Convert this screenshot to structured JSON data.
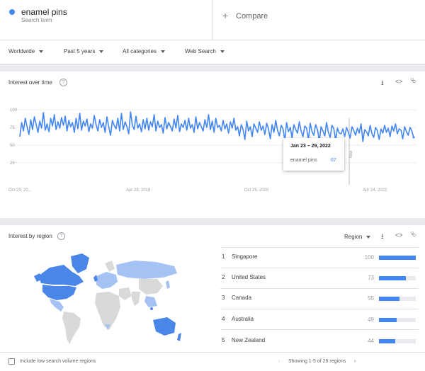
{
  "search": {
    "term": "enamel pins",
    "term_sub": "Search term",
    "compare_label": "Compare"
  },
  "filters": {
    "region": "Worldwide",
    "time": "Past 5 years",
    "category": "All categories",
    "property": "Web Search"
  },
  "interest_over_time": {
    "title": "Interest over time",
    "icons": [
      "download-icon",
      "embed-icon",
      "share-icon"
    ],
    "tooltip": {
      "date": "Jan 23 – 29, 2022",
      "series": "enamel pins",
      "value": "67"
    },
    "note": "Note"
  },
  "chart_data": {
    "type": "line",
    "title": "Interest over time",
    "xlabel": "",
    "ylabel": "",
    "x_tick_labels": [
      "Oct 29, 20...",
      "Apr 28, 2019",
      "Oct 25, 2020",
      "Apr 24, 2022"
    ],
    "y_ticks": [
      25,
      50,
      75,
      100
    ],
    "ylim": [
      0,
      100
    ],
    "grid": true,
    "series": [
      {
        "color": "#4285f4",
        "values": [
          62,
          82,
          70,
          88,
          76,
          65,
          86,
          72,
          90,
          79,
          68,
          84,
          74,
          96,
          71,
          80,
          69,
          88,
          77,
          93,
          72,
          83,
          74,
          89,
          78,
          91,
          70,
          85,
          76,
          82,
          68,
          88,
          73,
          95,
          71,
          84,
          77,
          87,
          69,
          80,
          74,
          92,
          79,
          70,
          86,
          75,
          82,
          68,
          90,
          76,
          64,
          85,
          78,
          73,
          88,
          70,
          95,
          72,
          83,
          76,
          66,
          97,
          78,
          72,
          91,
          74,
          80,
          69,
          86,
          73,
          88,
          71,
          83,
          76,
          93,
          70,
          84,
          75,
          79,
          67,
          89,
          73,
          82,
          76,
          70,
          87,
          74,
          92,
          69,
          80,
          75,
          85,
          71,
          88,
          74,
          79,
          68,
          90,
          73,
          82,
          76,
          70,
          86,
          75,
          93,
          72,
          84,
          68,
          88,
          75,
          78,
          70,
          85,
          73,
          80,
          67,
          83,
          74,
          88,
          71,
          76,
          63,
          79,
          72,
          58,
          84,
          70,
          76,
          62,
          80,
          74,
          68,
          83,
          71,
          77,
          65,
          81,
          73,
          59,
          79,
          68,
          85,
          71,
          63,
          78,
          73,
          57,
          82,
          69,
          75,
          60,
          79,
          72,
          67,
          83,
          70,
          62,
          77,
          74,
          58,
          81,
          69,
          64,
          79,
          72,
          56,
          76,
          70,
          63,
          82,
          68,
          61,
          78,
          73,
          57,
          74,
          67,
          66,
          73,
          62,
          75,
          68,
          60,
          76,
          71,
          64,
          74,
          67,
          80,
          55,
          72,
          69,
          63,
          78,
          66,
          61,
          75,
          70,
          58,
          73,
          67,
          78,
          68,
          74,
          62,
          77,
          70,
          80,
          66,
          73,
          71,
          59,
          76,
          69,
          64,
          75,
          70,
          61
        ]
      }
    ]
  },
  "interest_by_region": {
    "title": "Interest by region",
    "dropdown": "Region",
    "rows": [
      {
        "rank": "1",
        "name": "Singapore",
        "value": 100
      },
      {
        "rank": "2",
        "name": "United States",
        "value": 73
      },
      {
        "rank": "3",
        "name": "Canada",
        "value": 55
      },
      {
        "rank": "4",
        "name": "Australia",
        "value": 49
      },
      {
        "rank": "5",
        "name": "New Zealand",
        "value": 44
      }
    ],
    "checkbox_label": "Include low search volume regions",
    "pagination": "Showing 1-5 of 26 regions"
  },
  "colors": {
    "accent": "#4285f4",
    "map_high": "#4a86e8",
    "map_mid": "#a4c2f4",
    "map_none": "#d9d9d9"
  }
}
